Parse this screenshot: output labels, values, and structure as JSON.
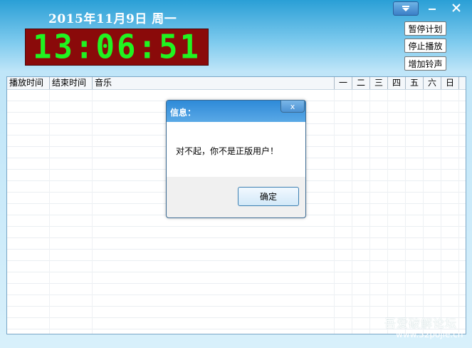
{
  "header": {
    "date_text": "2015年11月9日  周一",
    "clock_text": "13:06:51"
  },
  "window_controls": {
    "menu_icon": "triangle-down-icon",
    "minimize_icon": "minimize-icon",
    "close_icon": "close-icon"
  },
  "actions": {
    "pause_plan": "暂停计划",
    "stop_play": "停止播放",
    "add_bell": "增加铃声"
  },
  "table": {
    "columns": [
      "播放时间",
      "结束时间",
      "音乐"
    ],
    "days": [
      "一",
      "二",
      "三",
      "四",
      "五",
      "六",
      "日"
    ]
  },
  "dialog": {
    "title": "信息：",
    "message": "对不起，你不是正版用户！",
    "ok_label": "确定",
    "close_glyph": "x"
  },
  "watermark": {
    "text": "吾爱破解论坛",
    "url": "www.52pojie.cn"
  },
  "colors": {
    "clock_digits": "#21f321",
    "clock_bg": "#8a0a0a",
    "title_bar": "#2a9fd6"
  }
}
